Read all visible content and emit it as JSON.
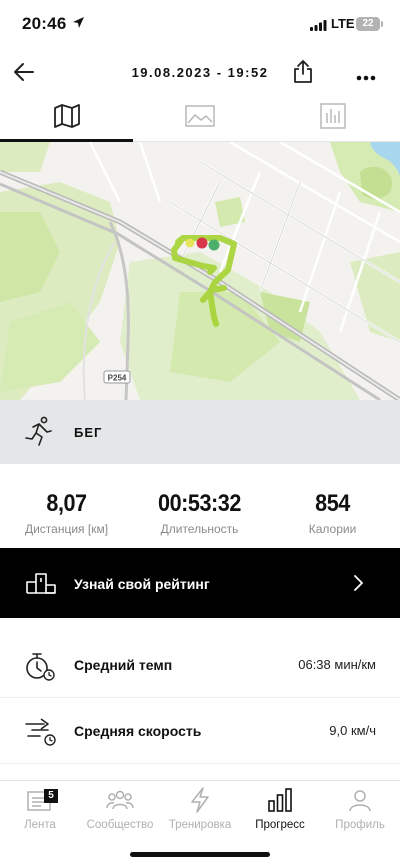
{
  "status_bar": {
    "time": "20:46",
    "network": "LTE",
    "battery": "22"
  },
  "header": {
    "title": "19.08.2023 - 19:52"
  },
  "tabs": [
    {
      "icon": "map-icon",
      "active": true
    },
    {
      "icon": "image-icon",
      "active": false
    },
    {
      "icon": "stats-icon",
      "active": false
    }
  ],
  "map": {
    "road_label": "P254"
  },
  "activity": {
    "label": "БЕГ",
    "icon": "running-icon"
  },
  "stats": [
    {
      "value": "8,07",
      "label": "Дистанция [км]"
    },
    {
      "value": "00:53:32",
      "label": "Длительность"
    },
    {
      "value": "854",
      "label": "Калории"
    }
  ],
  "rating": {
    "label": "Узнай свой рейтинг"
  },
  "metrics": [
    {
      "label": "Средний темп",
      "value": "06:38 мин/км",
      "icon": "pace-stopwatch-icon"
    },
    {
      "label": "Средняя скорость",
      "value": "9,0 км/ч",
      "icon": "speed-icon"
    }
  ],
  "nav": [
    {
      "label": "Лента",
      "icon": "feed-icon",
      "badge": "5",
      "active": false
    },
    {
      "label": "Сообщество",
      "icon": "community-icon",
      "active": false
    },
    {
      "label": "Тренировка",
      "icon": "lightning-icon",
      "active": false
    },
    {
      "label": "Прогресс",
      "icon": "progress-bars-icon",
      "active": true
    },
    {
      "label": "Профиль",
      "icon": "profile-icon",
      "active": false
    }
  ],
  "colors": {
    "accent": "#000000",
    "route": "#a8d43a",
    "inactive": "#b0b0b0"
  }
}
